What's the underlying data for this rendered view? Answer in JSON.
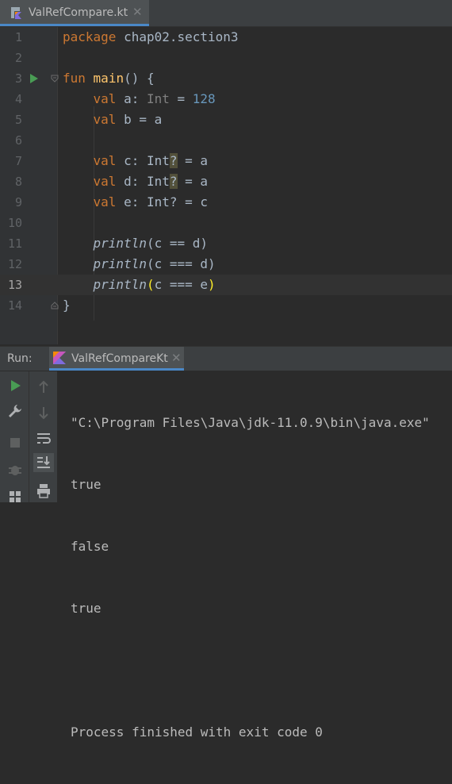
{
  "editor_tab": {
    "label": "ValRefCompare.kt",
    "close": "✕"
  },
  "code_lines": [
    {
      "num": "1"
    },
    {
      "num": "2"
    },
    {
      "num": "3"
    },
    {
      "num": "4"
    },
    {
      "num": "5"
    },
    {
      "num": "6"
    },
    {
      "num": "7"
    },
    {
      "num": "8"
    },
    {
      "num": "9"
    },
    {
      "num": "10"
    },
    {
      "num": "11"
    },
    {
      "num": "12"
    },
    {
      "num": "13"
    },
    {
      "num": "14"
    }
  ],
  "code": {
    "l1_kw": "package",
    "l1_rest": " chap02.section3",
    "l3_kw": "fun",
    "l3_fn": "main",
    "l3_rest": "() {",
    "l4_kw": "val",
    "l4_a": " a: ",
    "l4_type": "Int",
    "l4_eq": " = ",
    "l4_num": "128",
    "l5_kw": "val",
    "l5_rest": " b = a",
    "l7_kw": "val",
    "l7_a": " c: Int",
    "l7_q": "?",
    "l7_b": " = a",
    "l8_kw": "val",
    "l8_a": " d: Int",
    "l8_q": "?",
    "l8_b": " = a",
    "l9_kw": "val",
    "l9_rest": " e: Int? = c",
    "l11_fn": "println",
    "l11_rest": "(c == d)",
    "l12_fn": "println",
    "l12_rest": "(c === d)",
    "l13_fn": "println",
    "l13_open": "(",
    "l13_mid": "c === e",
    "l13_close": ")",
    "l14": "}"
  },
  "run_panel": {
    "title": "Run:",
    "tab_label": "ValRefCompareKt",
    "close": "✕",
    "console_lines": [
      "\"C:\\Program Files\\Java\\jdk-11.0.9\\bin\\java.exe\"",
      "true",
      "false",
      "true",
      "",
      "Process finished with exit code 0"
    ]
  }
}
